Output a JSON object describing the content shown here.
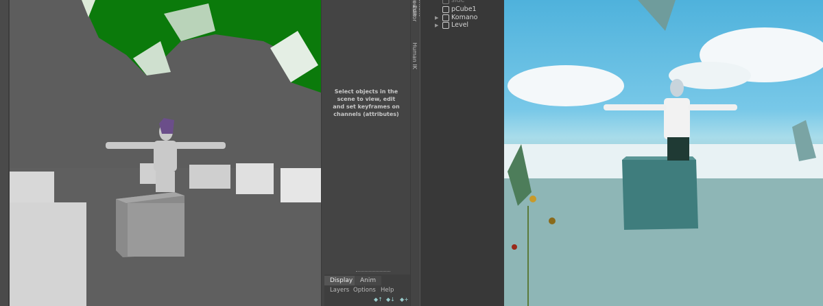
{
  "maya": {
    "channel_box": {
      "empty_message": "Select objects in the scene to view, edit and set keyframes on channels (attributes)"
    },
    "side_tabs": [
      "Attribute Editor",
      "Content Browser",
      "Human IK"
    ],
    "layer_editor": {
      "tabs": [
        "Display",
        "Anim"
      ],
      "active_tab": "Display",
      "menu": [
        "Layers",
        "Options",
        "Help"
      ],
      "icons": [
        "move-layer-up-icon",
        "move-layer-down-icon",
        "new-layer-icon"
      ]
    },
    "colors": {
      "viewport_bg": "#5d5d5d",
      "foliage": "#0a7a0a"
    }
  },
  "unity": {
    "hierarchy": {
      "items": [
        {
          "label": "side",
          "expandable": false,
          "faded": true
        },
        {
          "label": "pCube1",
          "expandable": false,
          "faded": false
        },
        {
          "label": "Komano",
          "expandable": true,
          "faded": false
        },
        {
          "label": "Level",
          "expandable": true,
          "faded": false
        }
      ]
    },
    "colors": {
      "sky": "#4fb2dc",
      "ground": "#8fb8b8",
      "cube": "#3f7d7d"
    }
  }
}
